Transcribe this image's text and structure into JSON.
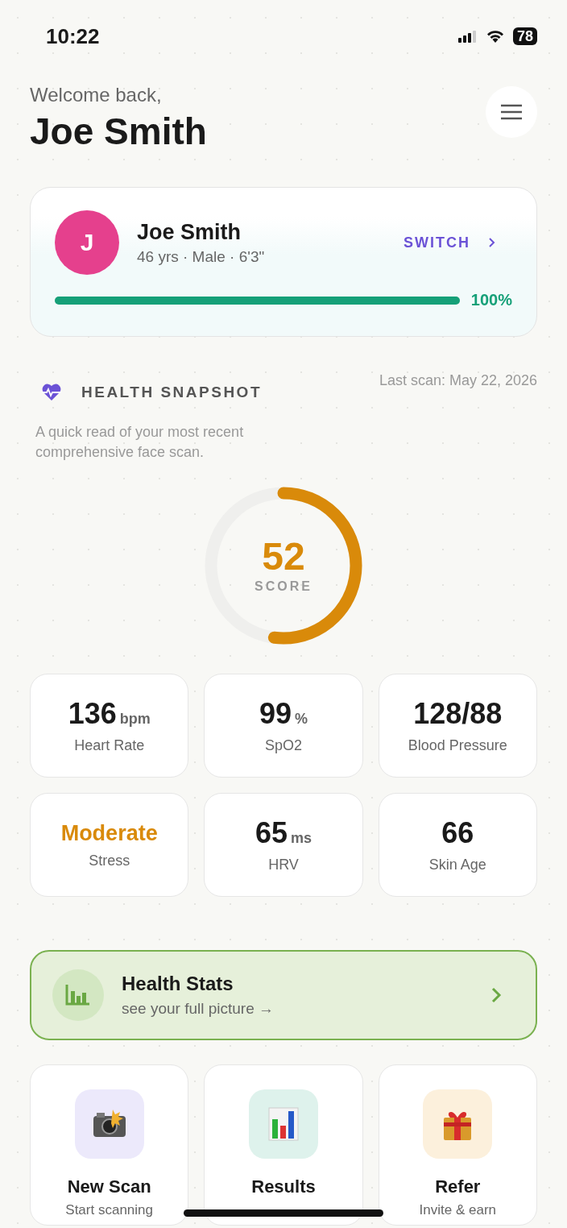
{
  "status_bar": {
    "time": "10:22",
    "battery": "78"
  },
  "header": {
    "greeting": "Welcome back,",
    "name": "Joe Smith"
  },
  "profile": {
    "initial": "J",
    "name": "Joe Smith",
    "details": "46 yrs · Male · 6'3\"",
    "switch_label": "SWITCH",
    "level": 1,
    "percent": "100%"
  },
  "snapshot": {
    "title": "HEALTH SNAPSHOT",
    "last_scan": "Last scan: May 22, 2026",
    "description": "A quick read of your most recent comprehensive face scan.",
    "score": "52",
    "score_label": "SCORE",
    "level": 0.52
  },
  "stats": [
    {
      "value": "136",
      "unit": "bpm",
      "label": "Heart Rate",
      "color": "#1a1a1a"
    },
    {
      "value": "99",
      "unit": "%",
      "label": "SpO2",
      "color": "#1a1a1a"
    },
    {
      "value": "128/88",
      "label": "Blood Pressure",
      "color": "#1a1a1a"
    },
    {
      "value": "Moderate",
      "label": "Stress",
      "color": "#d98a0a"
    },
    {
      "value": "65",
      "unit": "ms",
      "label": "HRV",
      "color": "#1a1a1a"
    },
    {
      "value": "66",
      "label": "Skin Age",
      "color": "#1a1a1a"
    }
  ],
  "health_stats": {
    "title": "Health Stats",
    "subtitle": "see your full picture →"
  },
  "actions": [
    {
      "kind": "camera",
      "title": "New Scan",
      "subtitle": "Start scanning",
      "color": "#ece9fb"
    },
    {
      "kind": "chart",
      "title": "Results",
      "color": "#def2ec"
    },
    {
      "kind": "gift",
      "title": "Refer",
      "subtitle": "Invite & earn",
      "color": "#fcf0dc"
    }
  ]
}
